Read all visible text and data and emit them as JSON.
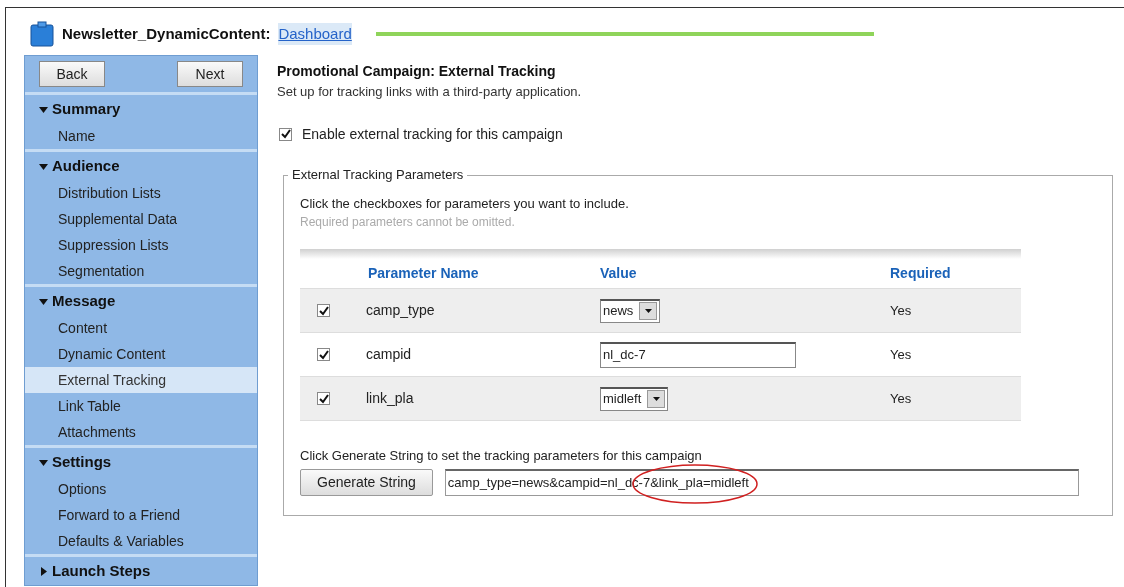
{
  "header": {
    "title": "Newsletter_DynamicContent:",
    "link": "Dashboard",
    "progress": {
      "level": 1
    }
  },
  "sidebar": {
    "buttons": [
      "Back",
      "Next"
    ],
    "groups": [
      {
        "label": "Summary",
        "expanded": true,
        "items": [
          {
            "label": "Name",
            "selected": false
          }
        ]
      },
      {
        "label": "Audience",
        "expanded": true,
        "items": [
          {
            "label": "Distribution Lists",
            "selected": false
          },
          {
            "label": "Supplemental Data",
            "selected": false
          },
          {
            "label": "Suppression Lists",
            "selected": false
          },
          {
            "label": "Segmentation",
            "selected": false
          }
        ]
      },
      {
        "label": "Message",
        "expanded": true,
        "items": [
          {
            "label": "Content",
            "selected": false
          },
          {
            "label": "Dynamic Content",
            "selected": false
          },
          {
            "label": "External Tracking",
            "selected": true
          },
          {
            "label": "Link Table",
            "selected": false
          },
          {
            "label": "Attachments",
            "selected": false
          }
        ]
      },
      {
        "label": "Settings",
        "expanded": true,
        "items": [
          {
            "label": "Options",
            "selected": false
          },
          {
            "label": "Forward to a Friend",
            "selected": false
          },
          {
            "label": "Defaults & Variables",
            "selected": false
          }
        ]
      },
      {
        "label": "Launch Steps",
        "expanded": false
      }
    ]
  },
  "main": {
    "title": "Promotional Campaign: External Tracking",
    "subtitle": "Set up for tracking links with a third-party application.",
    "enable": {
      "label": "Enable external tracking for this campaign",
      "checked": true
    },
    "fieldset": {
      "legend": "External Tracking Parameters",
      "instructions": "Click the checkboxes for parameters you want to include.",
      "note": "Required parameters cannot be omitted.",
      "table": {
        "columns": [
          "Parameter Name",
          "Value",
          "Required"
        ],
        "rows": [
          {
            "checked": true,
            "name": "camp_type",
            "kind": "select",
            "value": "news",
            "required": "Yes"
          },
          {
            "checked": true,
            "name": "campid",
            "kind": "text",
            "value": "nl_dc-7",
            "required": "Yes"
          },
          {
            "checked": true,
            "name": "link_pla",
            "kind": "select",
            "value": "midleft",
            "required": "Yes"
          }
        ]
      },
      "generate_hint": "Click Generate String to set the tracking parameters for this campaign",
      "generate_button": "Generate String",
      "generated": "camp_type=news&campid=nl_dc-7&link_pla=midleft"
    }
  }
}
